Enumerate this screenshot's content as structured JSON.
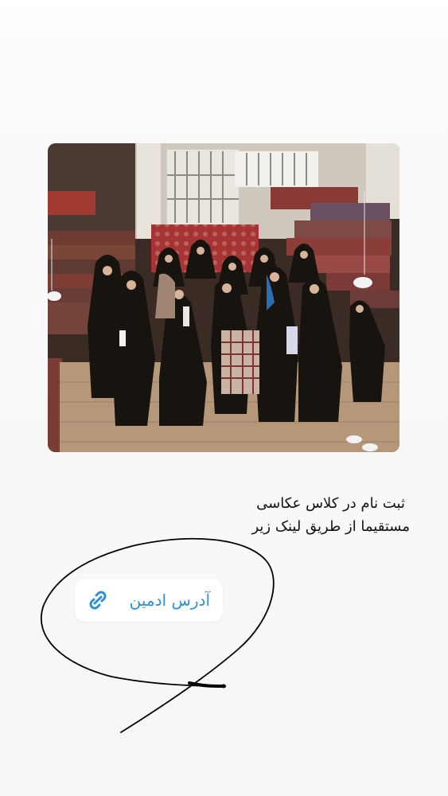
{
  "photo": {
    "subject": "group-photo-in-carpet-bazaar"
  },
  "caption": {
    "line1": "ثبت نام در کلاس عکاسی",
    "line2": "مستقیما از طریق لینک زیر"
  },
  "link_sticker": {
    "label": "آدرس ادمین",
    "icon": "link-icon",
    "accent_color": "#2f8fd1",
    "background_color": "#ffffff"
  },
  "drawing": {
    "type": "hand-drawn-circle-with-tail",
    "stroke_color": "#000000"
  }
}
